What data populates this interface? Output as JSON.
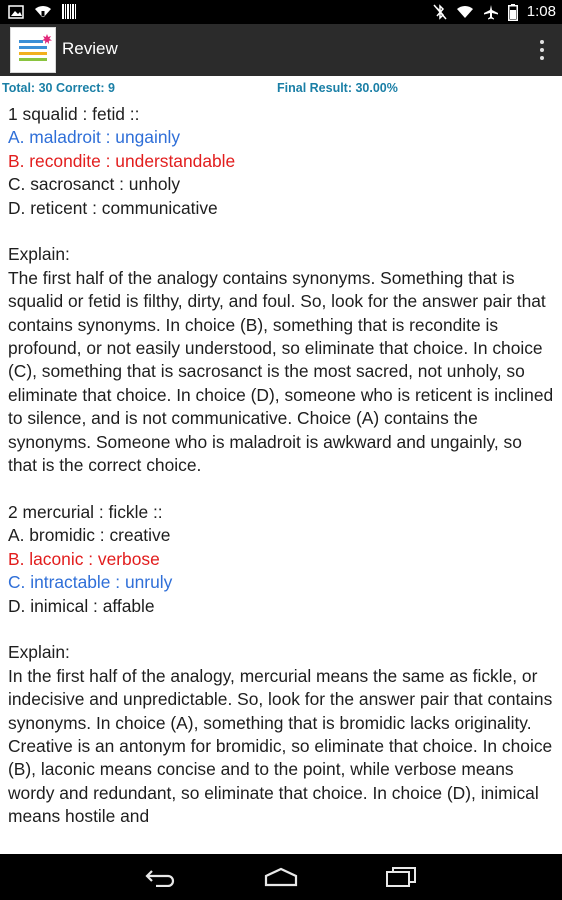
{
  "status_bar": {
    "time": "1:08",
    "icons": [
      "photo-icon",
      "wifi-icon",
      "barcode-icon",
      "bluetooth-off-icon",
      "wifi-icon",
      "airplane-icon",
      "battery-icon"
    ]
  },
  "action_bar": {
    "title": "Review",
    "app_icon": "app-logo-icon",
    "overflow_icon": "overflow-menu-icon"
  },
  "summary": {
    "totals": "Total: 30 Correct: 9",
    "final_result": "Final Result: 30.00%"
  },
  "questions": [
    {
      "question": "1 squalid : fetid ::",
      "options": [
        {
          "text": "A. maladroit : ungainly",
          "state": "correct"
        },
        {
          "text": "B. recondite : understandable",
          "state": "wrong"
        },
        {
          "text": "C. sacrosanct : unholy",
          "state": "normal"
        },
        {
          "text": "D. reticent : communicative",
          "state": "normal"
        }
      ],
      "explain_label": "Explain:",
      "explanation": "The first half of the analogy contains synonyms. Something that is squalid or fetid is filthy, dirty, and foul. So, look for the answer pair that contains synonyms. In choice (B), something that is recondite is profound, or not easily understood, so eliminate that choice. In choice (C), something that is sacrosanct is the most sacred, not unholy, so eliminate that choice. In choice (D), someone who is reticent is inclined to silence, and is not communicative. Choice (A) contains the synonyms. Someone who is maladroit is awkward and ungainly, so that is the correct choice."
    },
    {
      "question": "2 mercurial : fickle ::",
      "options": [
        {
          "text": "A. bromidic : creative",
          "state": "normal"
        },
        {
          "text": "B. laconic : verbose",
          "state": "wrong"
        },
        {
          "text": "C. intractable : unruly",
          "state": "correct"
        },
        {
          "text": "D. inimical : affable",
          "state": "normal"
        }
      ],
      "explain_label": "Explain:",
      "explanation": "In the first half of the analogy, mercurial means the same as fickle, or indecisive and unpredictable. So, look for the answer pair that contains synonyms. In choice (A), something that is bromidic lacks originality. Creative is an antonym for bromidic, so eliminate that choice. In choice (B), laconic means concise and to the point, while verbose means wordy and redundant, so eliminate that choice. In choice (D), inimical means hostile and"
    }
  ],
  "nav_bar": {
    "icons": [
      "back-icon",
      "home-icon",
      "recent-apps-icon"
    ]
  },
  "colors": {
    "correct": "#2f6fd8",
    "wrong": "#e21d1d",
    "summary": "#1a7fa6",
    "action_bar": "#2b2b2b"
  }
}
